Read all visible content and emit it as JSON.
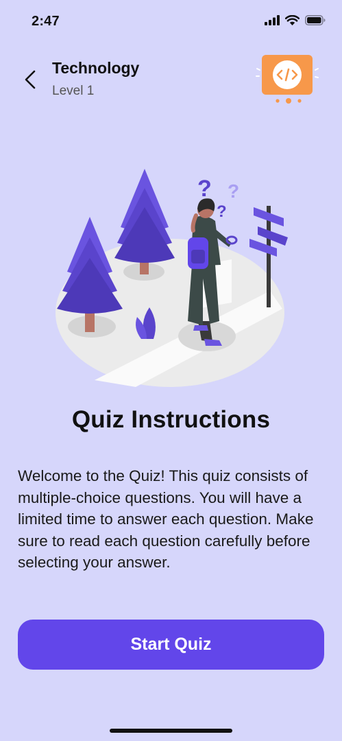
{
  "status_bar": {
    "time": "2:47"
  },
  "header": {
    "title": "Technology",
    "subtitle": "Level 1",
    "badge_icon": "code-icon"
  },
  "main": {
    "title": "Quiz Instructions",
    "instructions": "Welcome to the Quiz! This quiz consists of multiple-choice questions. You will have a limited time to answer each question. Make sure to read each question carefully before selecting your answer."
  },
  "actions": {
    "start_label": "Start Quiz"
  },
  "colors": {
    "background": "#d6d6fb",
    "accent": "#6246ea",
    "badge": "#f7984a"
  }
}
